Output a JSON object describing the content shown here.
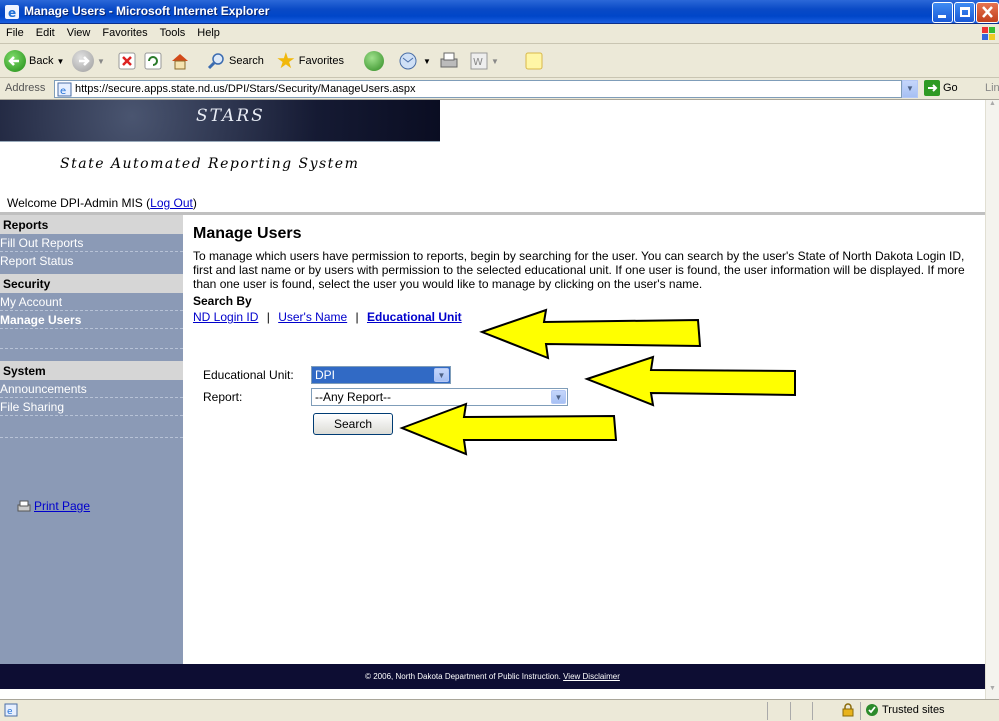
{
  "window": {
    "title": "Manage Users - Microsoft Internet Explorer"
  },
  "menu": {
    "items": [
      "File",
      "Edit",
      "View",
      "Favorites",
      "Tools",
      "Help"
    ]
  },
  "toolbar": {
    "back_label": "Back",
    "search_label": "Search",
    "favorites_label": "Favorites"
  },
  "address": {
    "label": "Address",
    "url": "https://secure.apps.state.nd.us/DPI/Stars/Security/ManageUsers.aspx",
    "go_label": "Go",
    "links_label": "Links"
  },
  "banner": {
    "title": "STARS",
    "subtitle": "State Automated Reporting System"
  },
  "welcome": {
    "prefix": "Welcome DPI-Admin MIS (",
    "logout": "Log Out",
    "suffix": ")"
  },
  "sidebar": {
    "sections": [
      {
        "heading": "Reports",
        "items": [
          {
            "label": "Fill Out Reports",
            "active": false
          },
          {
            "label": "Report Status",
            "active": false
          }
        ]
      },
      {
        "heading": "Security",
        "items": [
          {
            "label": "My Account",
            "active": false
          },
          {
            "label": "Manage Users",
            "active": true
          }
        ]
      },
      {
        "heading": "System",
        "items": [
          {
            "label": "Announcements",
            "active": false
          },
          {
            "label": "File Sharing",
            "active": false
          }
        ]
      }
    ],
    "print_label": "Print Page"
  },
  "main": {
    "title": "Manage Users",
    "intro": "To manage which users have permission to reports, begin by searching for the user. You can search by the user's State of North Dakota Login ID, first and last name or by users with permission to the selected educational unit. If one user is found, the user information will be displayed. If more than one user is found, select the user you would like to manage by clicking on the user's name.",
    "search_by_label": "Search By",
    "search_options": [
      "ND Login ID",
      "User's Name",
      "Educational Unit"
    ],
    "separator": "|",
    "form": {
      "edu_unit_label": "Educational Unit:",
      "edu_unit_value": "DPI",
      "report_label": "Report:",
      "report_value": "--Any Report--",
      "search_button": "Search"
    }
  },
  "footer": {
    "text": "© 2006, North Dakota Department of Public Instruction. ",
    "link": "View Disclaimer"
  },
  "status": {
    "zone": "Trusted sites"
  },
  "colors": {
    "sidebar": "#8b9ab6",
    "footer": "#0d0d33",
    "arrow": "#ffff00",
    "link": "#0000cc"
  }
}
